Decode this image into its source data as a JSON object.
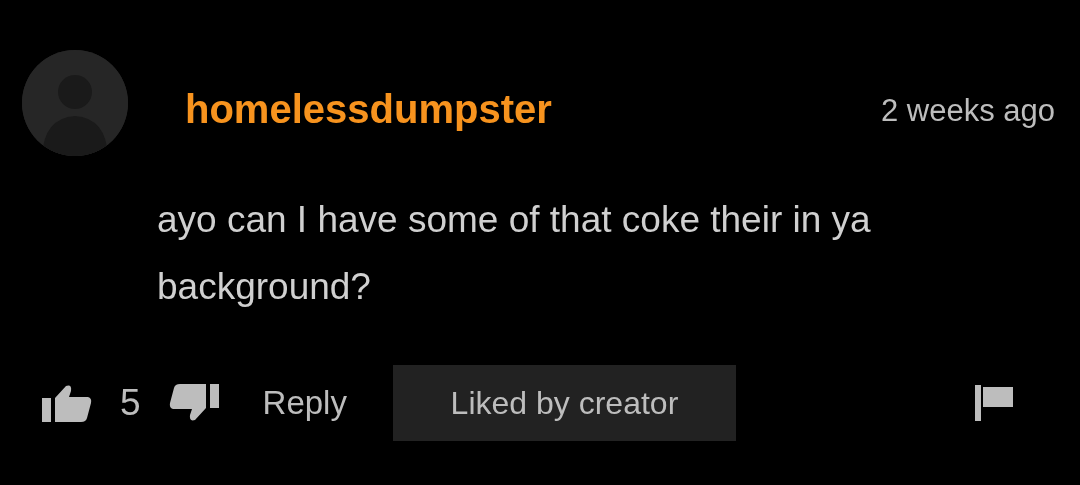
{
  "comment": {
    "username": "homelessdumpster",
    "time": "2 weeks ago",
    "text": "ayo can I have some of that coke their in ya background?",
    "likes": "5",
    "reply_label": "Reply",
    "liked_by_creator": true,
    "liked_label": "Liked by creator"
  }
}
